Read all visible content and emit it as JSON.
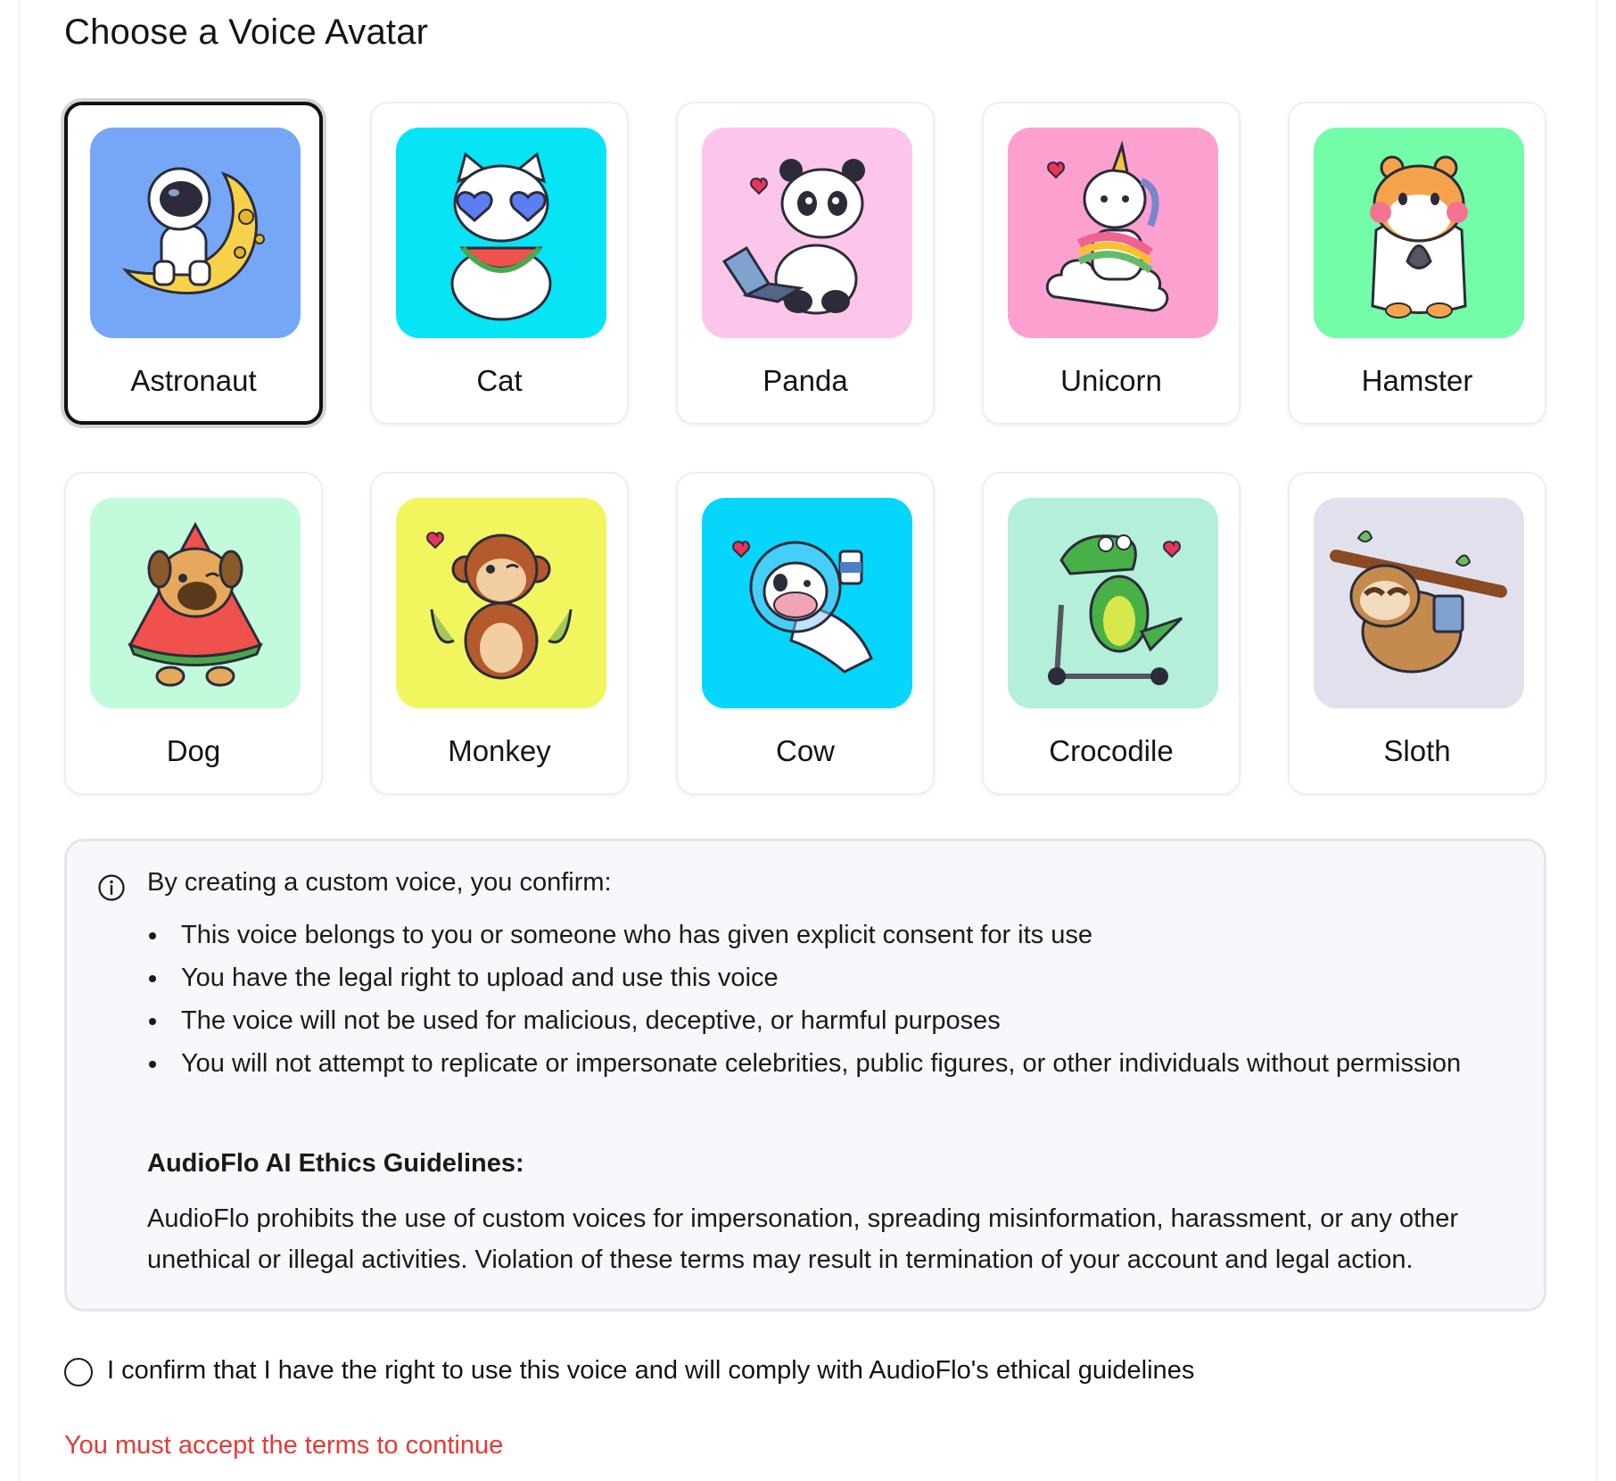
{
  "page": {
    "title": "Choose a Voice Avatar"
  },
  "avatars": [
    {
      "label": "Astronaut",
      "bg": "#76a7f7",
      "selected": true,
      "icon": "astronaut-on-moon-icon"
    },
    {
      "label": "Cat",
      "bg": "#06e4f6",
      "selected": false,
      "icon": "cat-with-watermelon-icon"
    },
    {
      "label": "Panda",
      "bg": "#fcc6ea",
      "selected": false,
      "icon": "panda-with-laptop-icon"
    },
    {
      "label": "Unicorn",
      "bg": "#fca0cf",
      "selected": false,
      "icon": "unicorn-on-cloud-icon"
    },
    {
      "label": "Hamster",
      "bg": "#73fda9",
      "selected": false,
      "icon": "hamster-with-seeds-icon"
    },
    {
      "label": "Dog",
      "bg": "#c2fbdc",
      "selected": false,
      "icon": "pug-in-watermelon-icon"
    },
    {
      "label": "Monkey",
      "bg": "#f1f65f",
      "selected": false,
      "icon": "monkey-with-bananas-icon"
    },
    {
      "label": "Cow",
      "bg": "#06d6fb",
      "selected": false,
      "icon": "cow-astronaut-icon"
    },
    {
      "label": "Crocodile",
      "bg": "#b3efd9",
      "selected": false,
      "icon": "crocodile-on-scooter-icon"
    },
    {
      "label": "Sloth",
      "bg": "#e1e1ee",
      "selected": false,
      "icon": "sloth-on-branch-icon"
    }
  ],
  "notice": {
    "icon": "info-icon",
    "intro": "By creating a custom voice, you confirm:",
    "bullets": [
      "This voice belongs to you or someone who has given explicit consent for its use",
      "You have the legal right to upload and use this voice",
      "The voice will not be used for malicious, deceptive, or harmful purposes",
      "You will not attempt to replicate or impersonate celebrities, public figures, or other individuals without permission"
    ],
    "guidelines_title": "AudioFlo AI Ethics Guidelines:",
    "guidelines_text": "AudioFlo prohibits the use of custom voices for impersonation, spreading misinformation, harassment, or any other unethical or illegal activities. Violation of these terms may result in termination of your account and legal action."
  },
  "confirm": {
    "label": "I confirm that I have the right to use this voice and will comply with AudioFlo's ethical guidelines",
    "checked": false
  },
  "error": "You must accept the terms to continue",
  "colors": {
    "selected_border": "#111111",
    "error": "#e53a35",
    "notice_bg": "#f7f8fc"
  }
}
